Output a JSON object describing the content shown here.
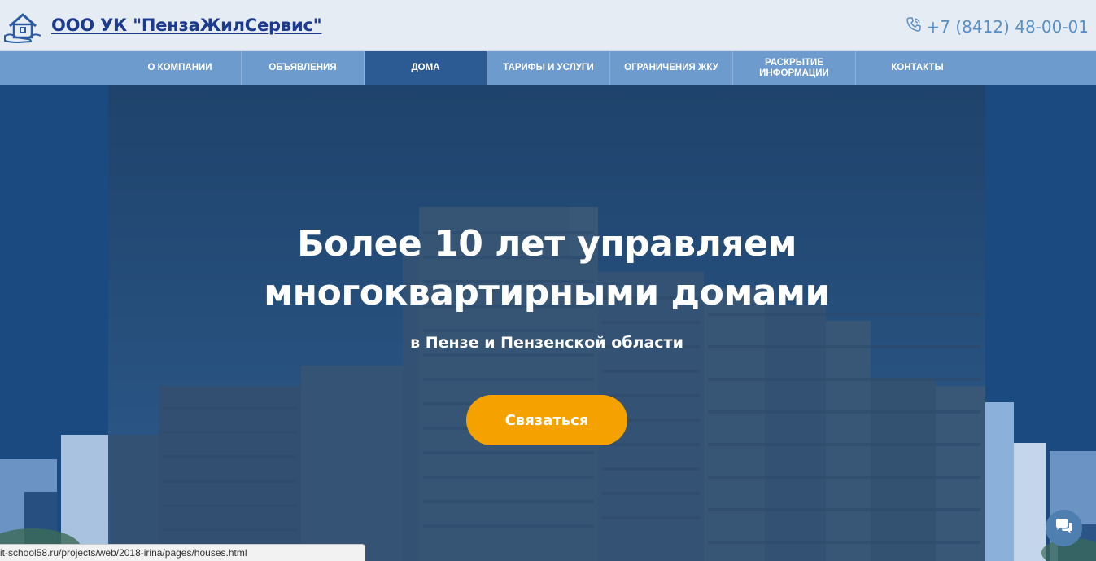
{
  "header": {
    "logo_icon": "house-hands-icon",
    "company_name": "ООО УК \"ПензаЖилСервис\"",
    "phone_icon": "phone-icon",
    "phone": "+7 (8412) 48-00-01"
  },
  "nav": {
    "items": [
      {
        "label": "О КОМПАНИИ"
      },
      {
        "label": "ОБЪЯВЛЕНИЯ"
      },
      {
        "label": "ДОМА"
      },
      {
        "label": "ТАРИФЫ И УСЛУГИ"
      },
      {
        "label": "ОГРАНИЧЕНИЯ ЖКУ"
      },
      {
        "label": "РАСКРЫТИЕ ИНФОРМАЦИИ"
      },
      {
        "label": "КОНТАКТЫ"
      }
    ],
    "active_index": 2
  },
  "hero": {
    "title_line1": "Более 10 лет управляем",
    "title_line2": "многоквартирными домами",
    "subtitle": "в Пензе и Пензенской области",
    "cta_label": "Связаться"
  },
  "statusbar": {
    "url": "it-school58.ru/projects/web/2018-irina/pages/houses.html"
  },
  "chat": {
    "icon": "chat-bubbles-icon"
  },
  "colors": {
    "brand_blue": "#1d3b8e",
    "nav_bg": "#6d9bcd",
    "nav_active": "#2b5b92",
    "cta": "#f5a200",
    "phone": "#5a8fc6"
  }
}
